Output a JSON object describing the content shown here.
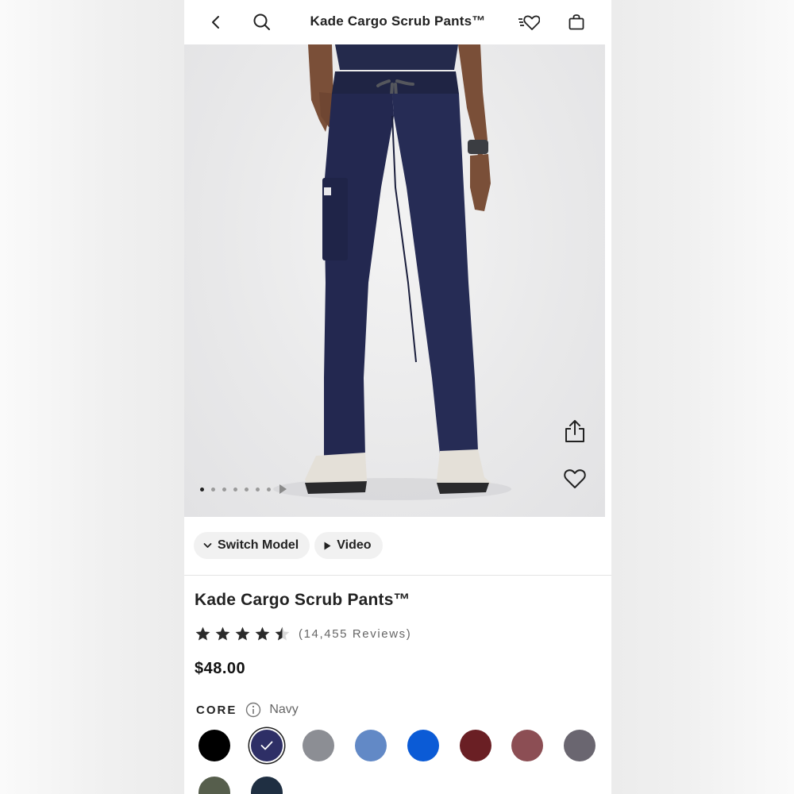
{
  "header": {
    "title": "Kade Cargo Scrub Pants™",
    "icons": [
      "back-icon",
      "search-icon",
      "wishlist-icon",
      "bag-icon"
    ]
  },
  "gallery": {
    "image_count": 7,
    "active_index": 0,
    "actions": [
      "share-icon",
      "heart-icon"
    ]
  },
  "pills": [
    {
      "label": "Switch Model",
      "icon": "chevron-down-icon"
    },
    {
      "label": "Video",
      "icon": "play-icon"
    }
  ],
  "product": {
    "title": "Kade Cargo Scrub Pants™",
    "rating": 4.5,
    "rating_max": 5,
    "reviews_label": "(14,455 Reviews)",
    "price": "$48.00"
  },
  "colors": {
    "group_label": "CORE",
    "selected_name": "Navy",
    "swatches": [
      {
        "color": "#000000",
        "selected": false
      },
      {
        "color": "#2e2f66",
        "selected": true
      },
      {
        "color": "#8c8e94",
        "selected": false
      },
      {
        "color": "#6289c6",
        "selected": false
      },
      {
        "color": "#0b5bd6",
        "selected": false
      },
      {
        "color": "#6a1f24",
        "selected": false
      },
      {
        "color": "#8c4e54",
        "selected": false
      },
      {
        "color": "#6a6670",
        "selected": false
      },
      {
        "color": "#565e4c",
        "selected": false
      },
      {
        "color": "#1f2f42",
        "selected": false
      }
    ]
  }
}
